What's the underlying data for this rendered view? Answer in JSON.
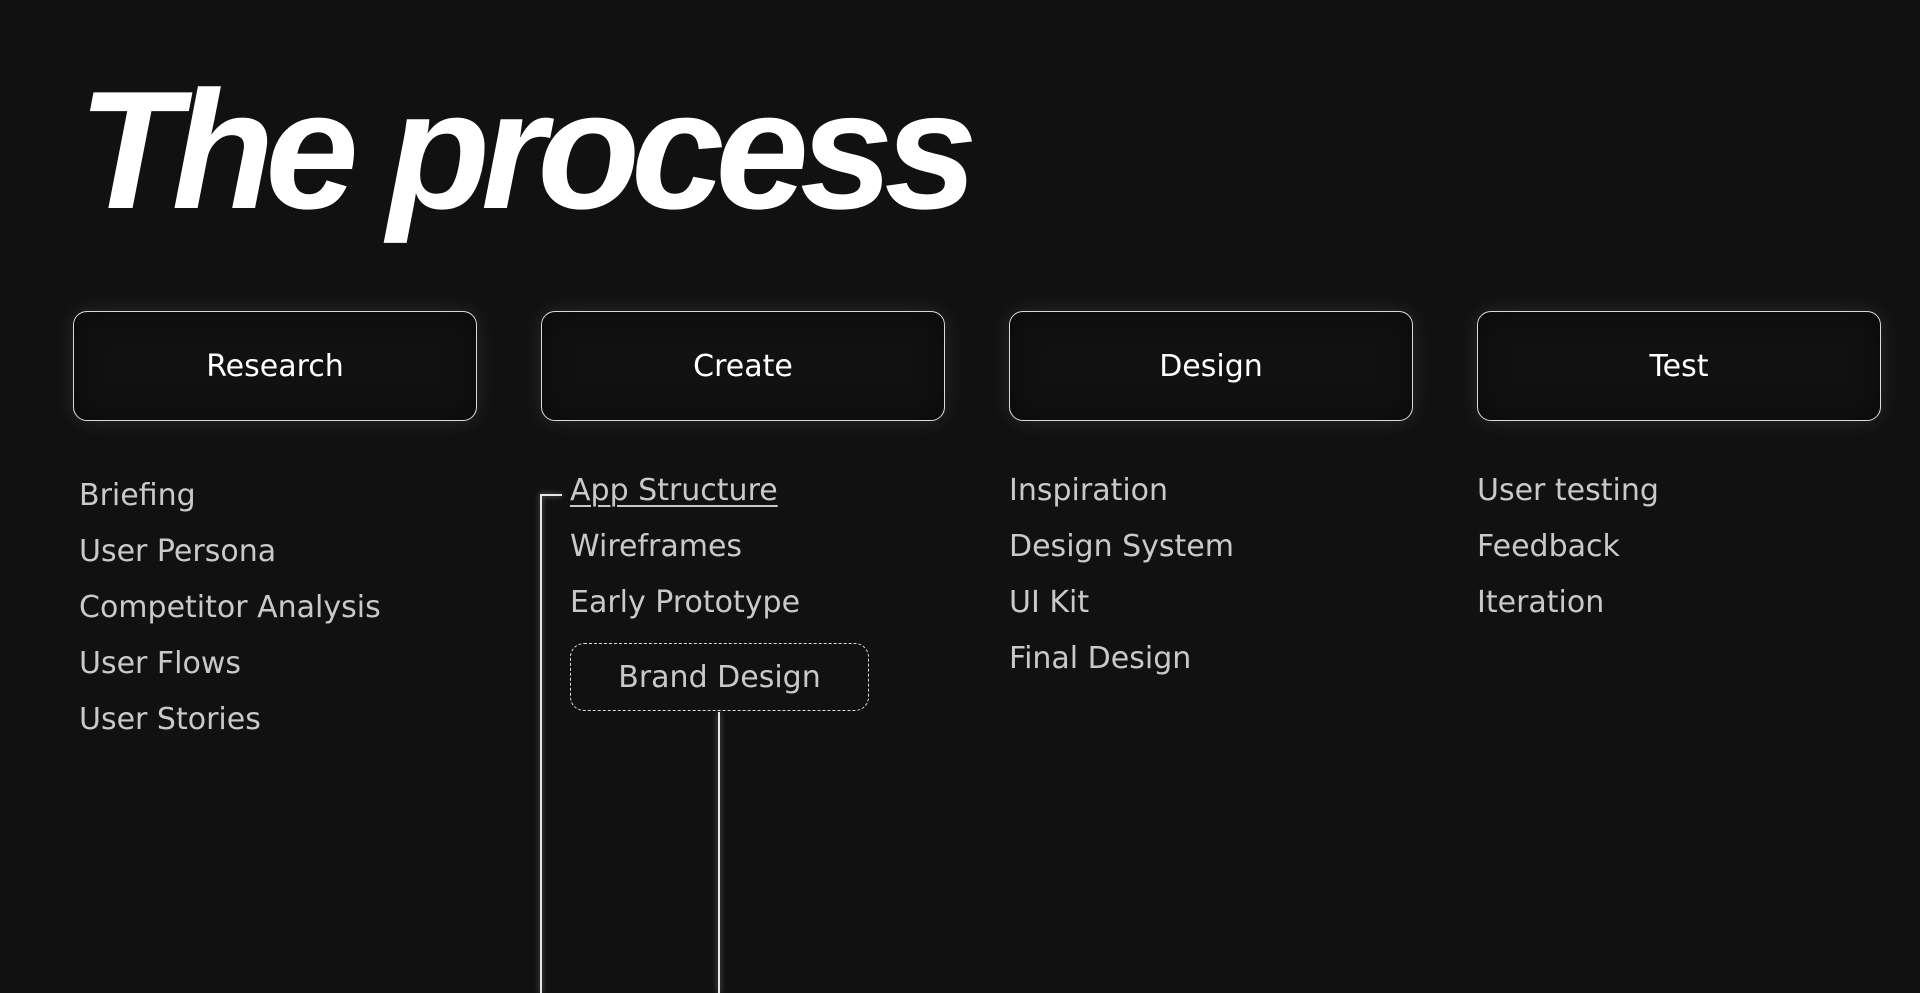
{
  "title": "The process",
  "stages": [
    {
      "label": "Research",
      "items": [
        "Briefing",
        "User Persona",
        "Competitor Analysis",
        "User Flows",
        "User Stories"
      ]
    },
    {
      "label": "Create",
      "items": [
        "App Structure",
        "Wireframes",
        "Early Prototype"
      ],
      "highlighted_item": "Brand Design"
    },
    {
      "label": "Design",
      "items": [
        "Inspiration",
        "Design System",
        "UI Kit",
        "Final Design"
      ]
    },
    {
      "label": "Test",
      "items": [
        "User testing",
        "Feedback",
        "Iteration"
      ]
    }
  ],
  "colors": {
    "background": "#111111",
    "title": "#ffffff",
    "stage_border": "#d9d9d9",
    "item_text": "#c9c9c9",
    "connector": "#e6e6e6"
  }
}
